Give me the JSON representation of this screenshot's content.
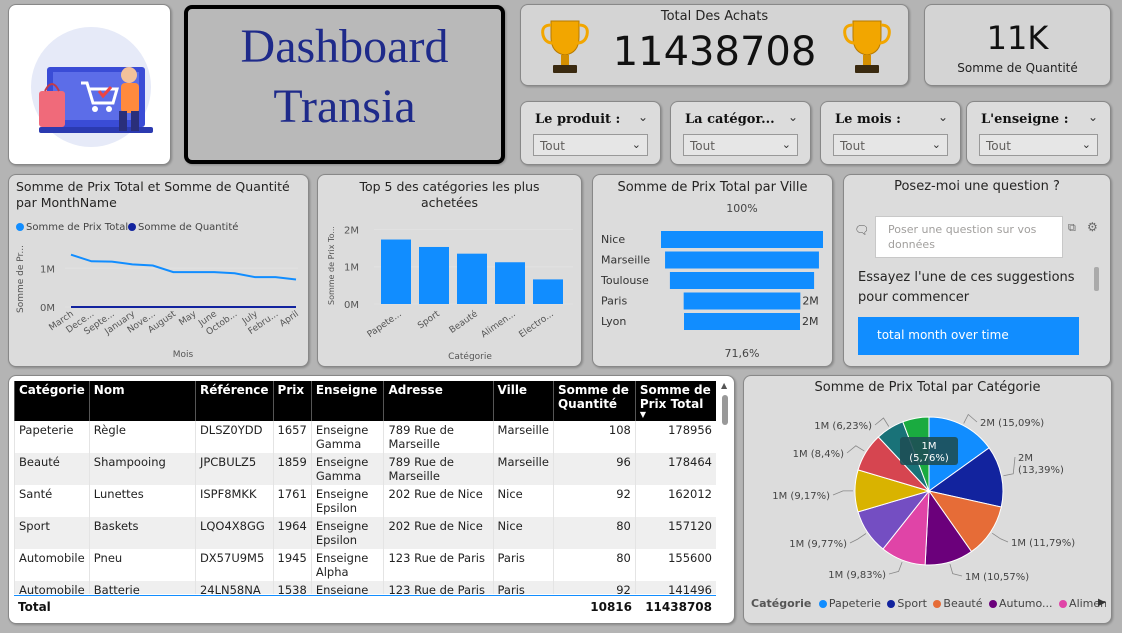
{
  "title": {
    "line1": "Dashboard",
    "line2": "Transia"
  },
  "kpi_total": {
    "label": "Total Des Achats",
    "value": "11438708"
  },
  "kpi_qty": {
    "value": "11K",
    "label": "Somme de Quantité"
  },
  "slicers": [
    {
      "label": "Le produit :",
      "value": "Tout"
    },
    {
      "label": "La catégor...",
      "value": "Tout"
    },
    {
      "label": "Le mois :",
      "value": "Tout"
    },
    {
      "label": "L'enseigne :",
      "value": "Tout"
    }
  ],
  "line_chart": {
    "title": "Somme de Prix Total et Somme de Quantité par MonthName",
    "legend": [
      "Somme de Prix Total",
      "Somme de Quantité"
    ],
    "colors": [
      "#118dff",
      "#12239e"
    ],
    "ylabel": "Somme de Pr...",
    "xlabel": "Mois",
    "yticks": [
      "1M",
      "0M"
    ]
  },
  "bar_chart": {
    "title": "Top 5 des catégories les plus achetées",
    "ylabel": "Somme de Prix To...",
    "xlabel": "Catégorie",
    "yticks": [
      "2M",
      "1M",
      "0M"
    ]
  },
  "funnel": {
    "title": "Somme de Prix Total par Ville",
    "top_pct": "100%",
    "bottom_pct": "71,6%",
    "data_labels": [
      "2M",
      "2M"
    ]
  },
  "qa": {
    "title": "Posez-moi une question ?",
    "placeholder": "Poser une question sur vos données",
    "suggest": "Essayez l'une de ces suggestions pour commencer",
    "button": "total month over time"
  },
  "table": {
    "headers": [
      "Catégorie",
      "Nom",
      "Référence",
      "Prix",
      "Enseigne",
      "Adresse",
      "Ville",
      "Somme de Quantité",
      "Somme de Prix Total"
    ],
    "rows": [
      [
        "Papeterie",
        "Règle",
        "DLSZ0YDD",
        "1657",
        "Enseigne Gamma",
        "789 Rue de Marseille",
        "Marseille",
        "108",
        "178956"
      ],
      [
        "Beauté",
        "Shampooing",
        "JPCBULZ5",
        "1859",
        "Enseigne Gamma",
        "789 Rue de Marseille",
        "Marseille",
        "96",
        "178464"
      ],
      [
        "Santé",
        "Lunettes",
        "ISPF8MKK",
        "1761",
        "Enseigne Epsilon",
        "202 Rue de Nice",
        "Nice",
        "92",
        "162012"
      ],
      [
        "Sport",
        "Baskets",
        "LQO4X8GG",
        "1964",
        "Enseigne Epsilon",
        "202 Rue de Nice",
        "Nice",
        "80",
        "157120"
      ],
      [
        "Automobile",
        "Pneu",
        "DX57U9M5",
        "1945",
        "Enseigne Alpha",
        "123 Rue de Paris",
        "Paris",
        "80",
        "155600"
      ],
      [
        "Automobile",
        "Batterie",
        "24LN58NA",
        "1538",
        "Enseigne",
        "123 Rue de Paris",
        "Paris",
        "92",
        "141496"
      ]
    ],
    "total": {
      "label": "Total",
      "qty": "10816",
      "prix": "11438708"
    }
  },
  "pie": {
    "title": "Somme de Prix Total par Catégorie",
    "legend_title": "Catégorie",
    "legend": [
      {
        "name": "Papeterie",
        "color": "#118dff"
      },
      {
        "name": "Sport",
        "color": "#12239e"
      },
      {
        "name": "Beauté",
        "color": "#e66c37"
      },
      {
        "name": "Autumo...",
        "color": "#6b007b"
      },
      {
        "name": "Aliment...",
        "color": "#e044a7"
      }
    ]
  },
  "chart_data": [
    {
      "type": "line",
      "title": "Somme de Prix Total et Somme de Quantité par MonthName",
      "xlabel": "Mois",
      "ylabel": "Somme de Pr...",
      "categories": [
        "March",
        "Dece...",
        "Septe...",
        "January",
        "Nove...",
        "August",
        "May",
        "June",
        "Octob...",
        "July",
        "Febru...",
        "April"
      ],
      "series": [
        {
          "name": "Somme de Prix Total",
          "values": [
            1.35,
            1.18,
            1.17,
            1.1,
            1.07,
            0.9,
            0.9,
            0.9,
            0.87,
            0.77,
            0.77,
            0.71
          ]
        },
        {
          "name": "Somme de Quantité",
          "values": [
            0.001,
            0.001,
            0.001,
            0.001,
            0.001,
            0.001,
            0.001,
            0.001,
            0.001,
            0.001,
            0.001,
            0.001
          ]
        }
      ],
      "ylim": [
        0,
        1.6
      ],
      "unit": "M"
    },
    {
      "type": "bar",
      "title": "Top 5 des catégories les plus achetées",
      "xlabel": "Catégorie",
      "ylabel": "Somme de Prix To...",
      "categories": [
        "Papete...",
        "Sport",
        "Beauté",
        "Alimen...",
        "Electro..."
      ],
      "values": [
        1.73,
        1.53,
        1.35,
        1.12,
        0.66
      ],
      "ylim": [
        0,
        2.2
      ],
      "unit": "M"
    },
    {
      "type": "bar",
      "title": "Somme de Prix Total par Ville",
      "categories": [
        "Nice",
        "Marseille",
        "Toulouse",
        "Paris",
        "Lyon"
      ],
      "values": [
        100,
        95,
        89,
        72,
        71.6
      ],
      "unit": "%"
    },
    {
      "type": "pie",
      "title": "Somme de Prix Total par Catégorie",
      "slices": [
        {
          "label": "Papeterie",
          "value": 15.09,
          "text": "2M (15,09%)",
          "color": "#118dff"
        },
        {
          "label": "Sport",
          "value": 13.39,
          "text": "2M (13,39%)",
          "color": "#12239e"
        },
        {
          "label": "Beauté",
          "value": 11.79,
          "text": "1M (11,79%)",
          "color": "#e66c37"
        },
        {
          "label": "Autumo...",
          "value": 10.57,
          "text": "1M (10,57%)",
          "color": "#6b007b"
        },
        {
          "label": "Aliment...",
          "value": 9.83,
          "text": "1M (9,83%)",
          "color": "#e044a7"
        },
        {
          "label": "",
          "value": 9.77,
          "text": "1M (9,77%)",
          "color": "#744ec2"
        },
        {
          "label": "",
          "value": 9.17,
          "text": "1M (9,17%)",
          "color": "#d9b300"
        },
        {
          "label": "",
          "value": 8.4,
          "text": "1M (8,4%)",
          "color": "#d64550"
        },
        {
          "label": "",
          "value": 6.23,
          "text": "1M (6,23%)",
          "color": "#197278"
        },
        {
          "label": "",
          "value": 5.76,
          "text": "1M (5,76%)",
          "color": "#1aab40"
        }
      ]
    }
  ]
}
